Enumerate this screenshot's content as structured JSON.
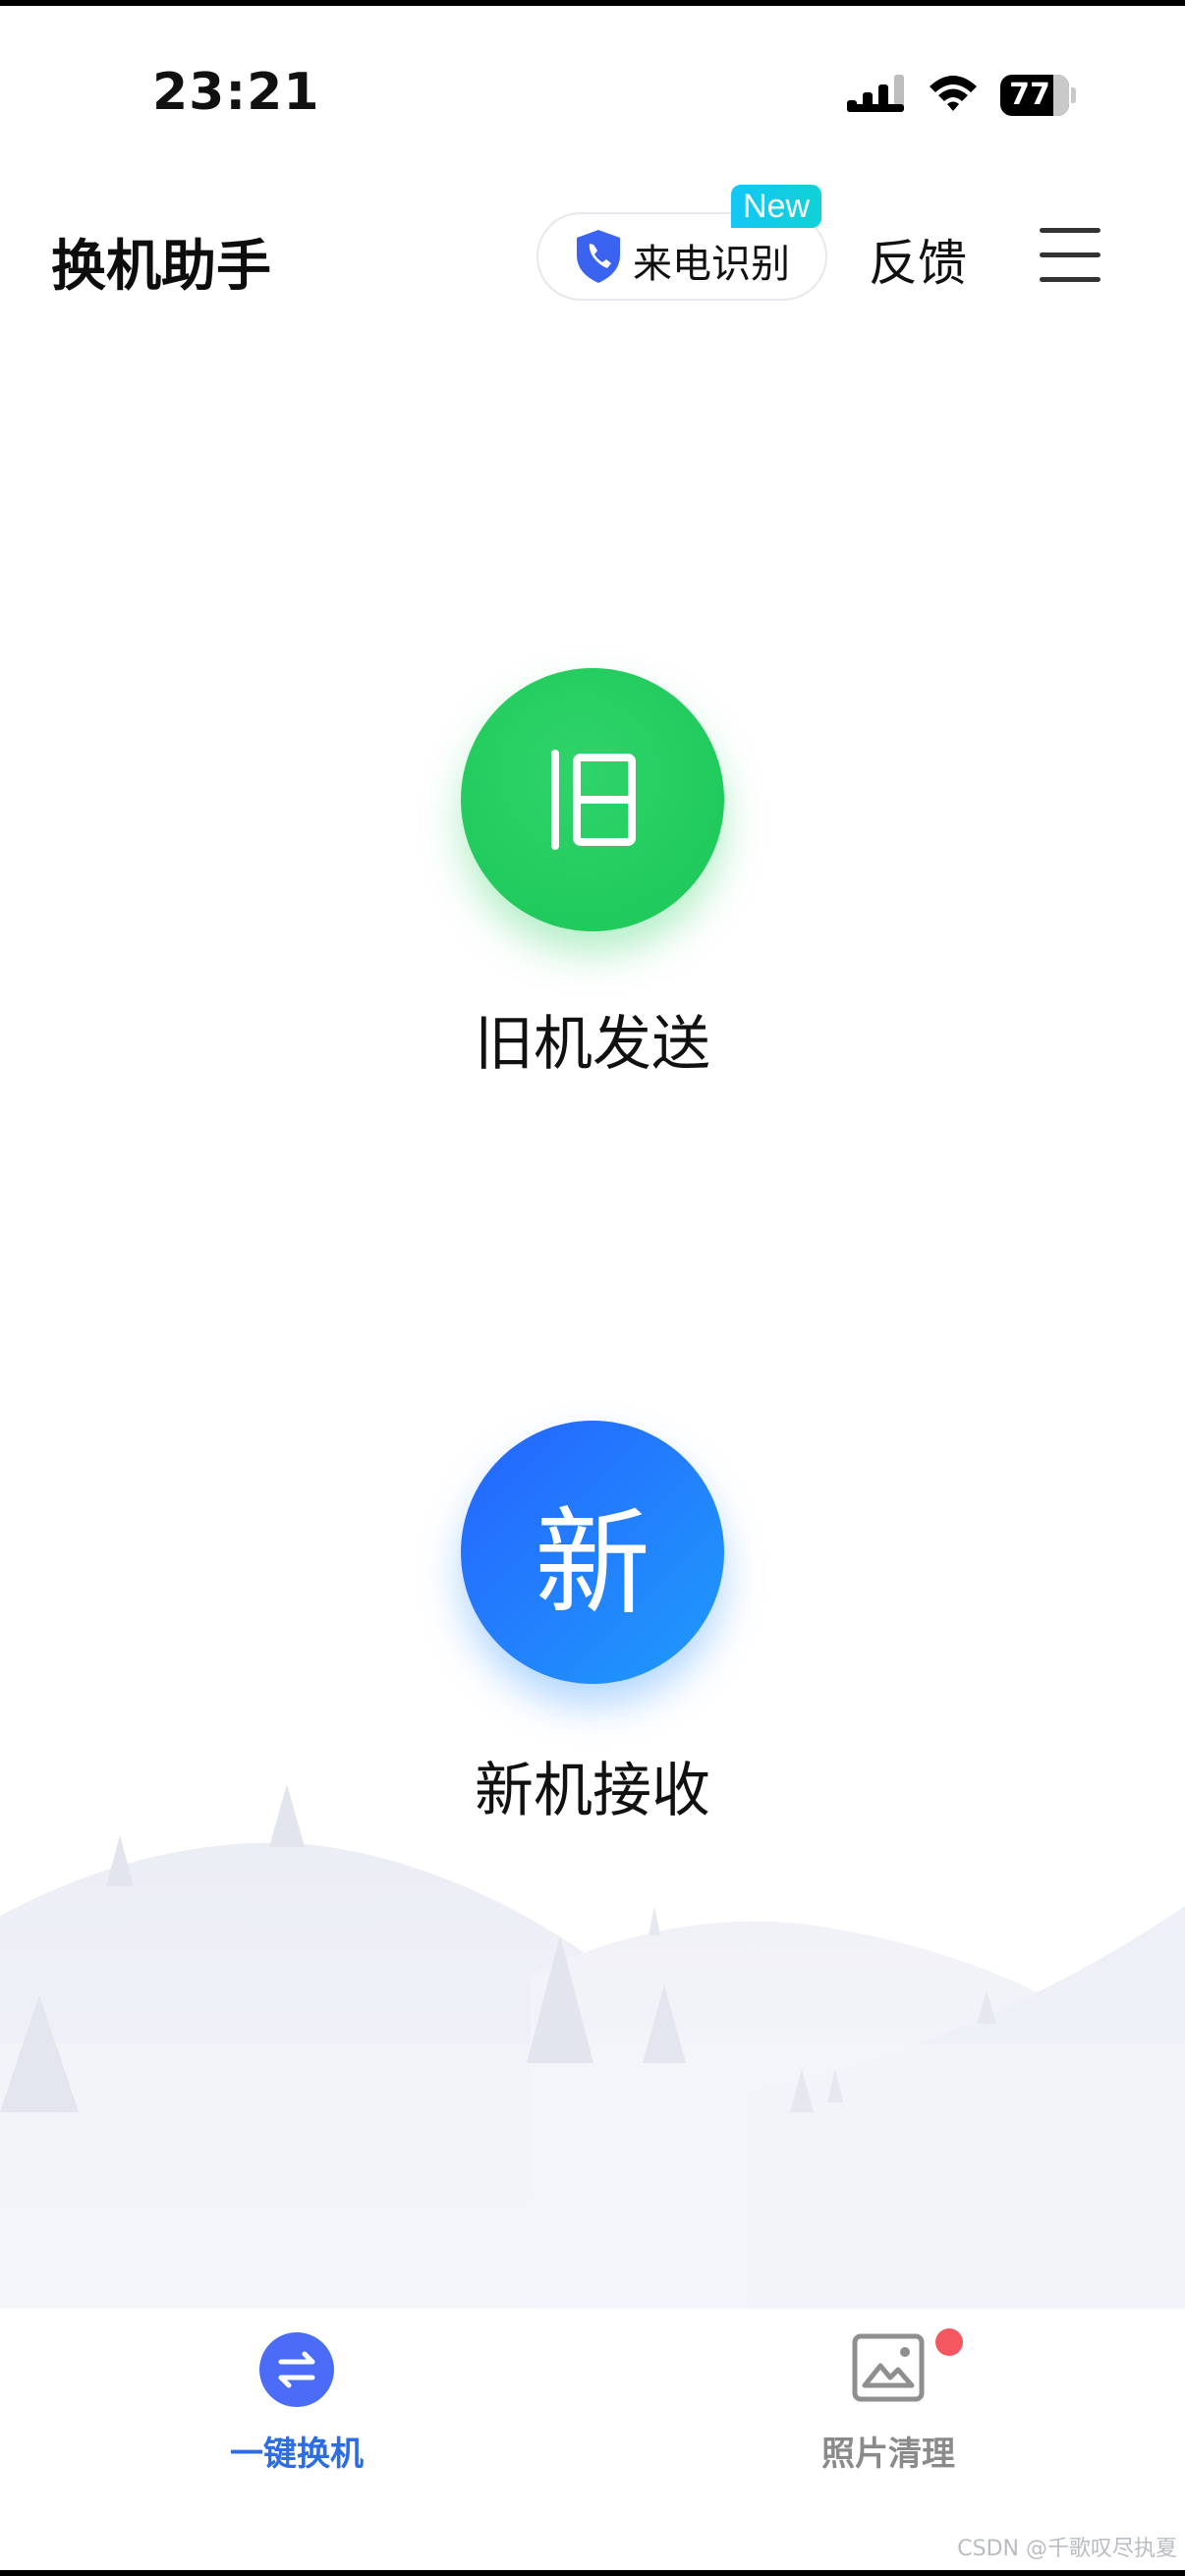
{
  "status_bar": {
    "time": "23:21",
    "battery": "77"
  },
  "header": {
    "title": "换机助手",
    "caller_id_label": "来电识别",
    "new_badge": "New",
    "feedback_label": "反馈"
  },
  "main": {
    "old_device": {
      "glyph": "旧",
      "label": "旧机发送",
      "color": "#22c95f"
    },
    "new_device": {
      "glyph": "新",
      "label": "新机接收",
      "color": "#2479fd"
    }
  },
  "bottom_nav": [
    {
      "label": "一键换机",
      "icon": "swap-arrows-icon",
      "active": true
    },
    {
      "label": "照片清理",
      "icon": "photo-icon",
      "active": false,
      "badge_dot": true
    }
  ],
  "watermark": "CSDN @千歌叹尽执夏",
  "colors": {
    "accent": "#2c6de6",
    "green": "#22c95f",
    "blue": "#2479fd",
    "badge": "#13c6f5",
    "dot": "#f4575f"
  }
}
